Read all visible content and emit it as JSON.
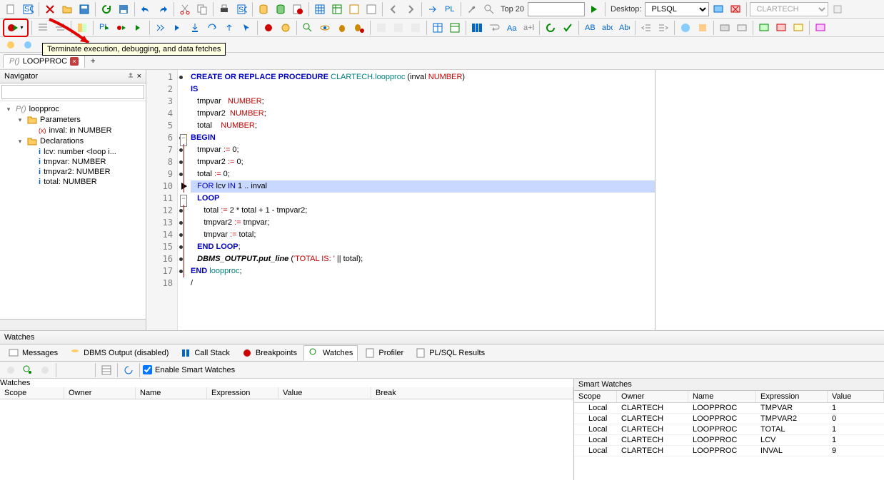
{
  "toolbar_top": {
    "top20_label": "Top 20",
    "desktop_label": "Desktop:",
    "desktop_value": "PLSQL",
    "schema_value": "CLARTECH"
  },
  "tooltip_text": "Terminate execution, debugging, and data fetches",
  "document_tab": {
    "prefix": "P()",
    "name": "LOOPPROC"
  },
  "navigator": {
    "title": "Navigator",
    "root": "loopproc",
    "parameters_label": "Parameters",
    "param1": "inval: in NUMBER",
    "declarations_label": "Declarations",
    "decl1": "lcv: number <loop i...",
    "decl2": "tmpvar: NUMBER",
    "decl3": "tmpvar2: NUMBER",
    "decl4": "total: NUMBER"
  },
  "code": {
    "lines": [
      {
        "n": 1,
        "dot": true
      },
      {
        "n": 2
      },
      {
        "n": 3
      },
      {
        "n": 4
      },
      {
        "n": 5
      },
      {
        "n": 6,
        "dot": true,
        "fold": "-"
      },
      {
        "n": 7,
        "dot": true
      },
      {
        "n": 8,
        "dot": true
      },
      {
        "n": 9,
        "dot": true
      },
      {
        "n": 10,
        "ptr": true,
        "hl": true
      },
      {
        "n": 11,
        "fold": "-"
      },
      {
        "n": 12,
        "dot": true
      },
      {
        "n": 13,
        "dot": true
      },
      {
        "n": 14,
        "dot": true
      },
      {
        "n": 15,
        "dot": true
      },
      {
        "n": 16,
        "dot": true
      },
      {
        "n": 17,
        "dot": true
      },
      {
        "n": 18
      }
    ]
  },
  "watches_panel": {
    "title": "Watches",
    "tabs": {
      "messages": "Messages",
      "dbms": "DBMS Output (disabled)",
      "callstack": "Call Stack",
      "breakpoints": "Breakpoints",
      "watches": "Watches",
      "profiler": "Profiler",
      "plsql": "PL/SQL Results"
    },
    "smart_label": "Enable Smart Watches",
    "watches_hdr": "Watches",
    "smart_hdr": "Smart Watches",
    "cols": {
      "scope": "Scope",
      "owner": "Owner",
      "name": "Name",
      "expression": "Expression",
      "value": "Value",
      "break": "Break"
    },
    "smart_rows": [
      {
        "scope": "Local",
        "owner": "CLARTECH",
        "name": "LOOPPROC",
        "expr": "TMPVAR",
        "val": "1"
      },
      {
        "scope": "Local",
        "owner": "CLARTECH",
        "name": "LOOPPROC",
        "expr": "TMPVAR2",
        "val": "0"
      },
      {
        "scope": "Local",
        "owner": "CLARTECH",
        "name": "LOOPPROC",
        "expr": "TOTAL",
        "val": "1"
      },
      {
        "scope": "Local",
        "owner": "CLARTECH",
        "name": "LOOPPROC",
        "expr": "LCV",
        "val": "1"
      },
      {
        "scope": "Local",
        "owner": "CLARTECH",
        "name": "LOOPPROC",
        "expr": "INVAL",
        "val": "9"
      }
    ]
  }
}
